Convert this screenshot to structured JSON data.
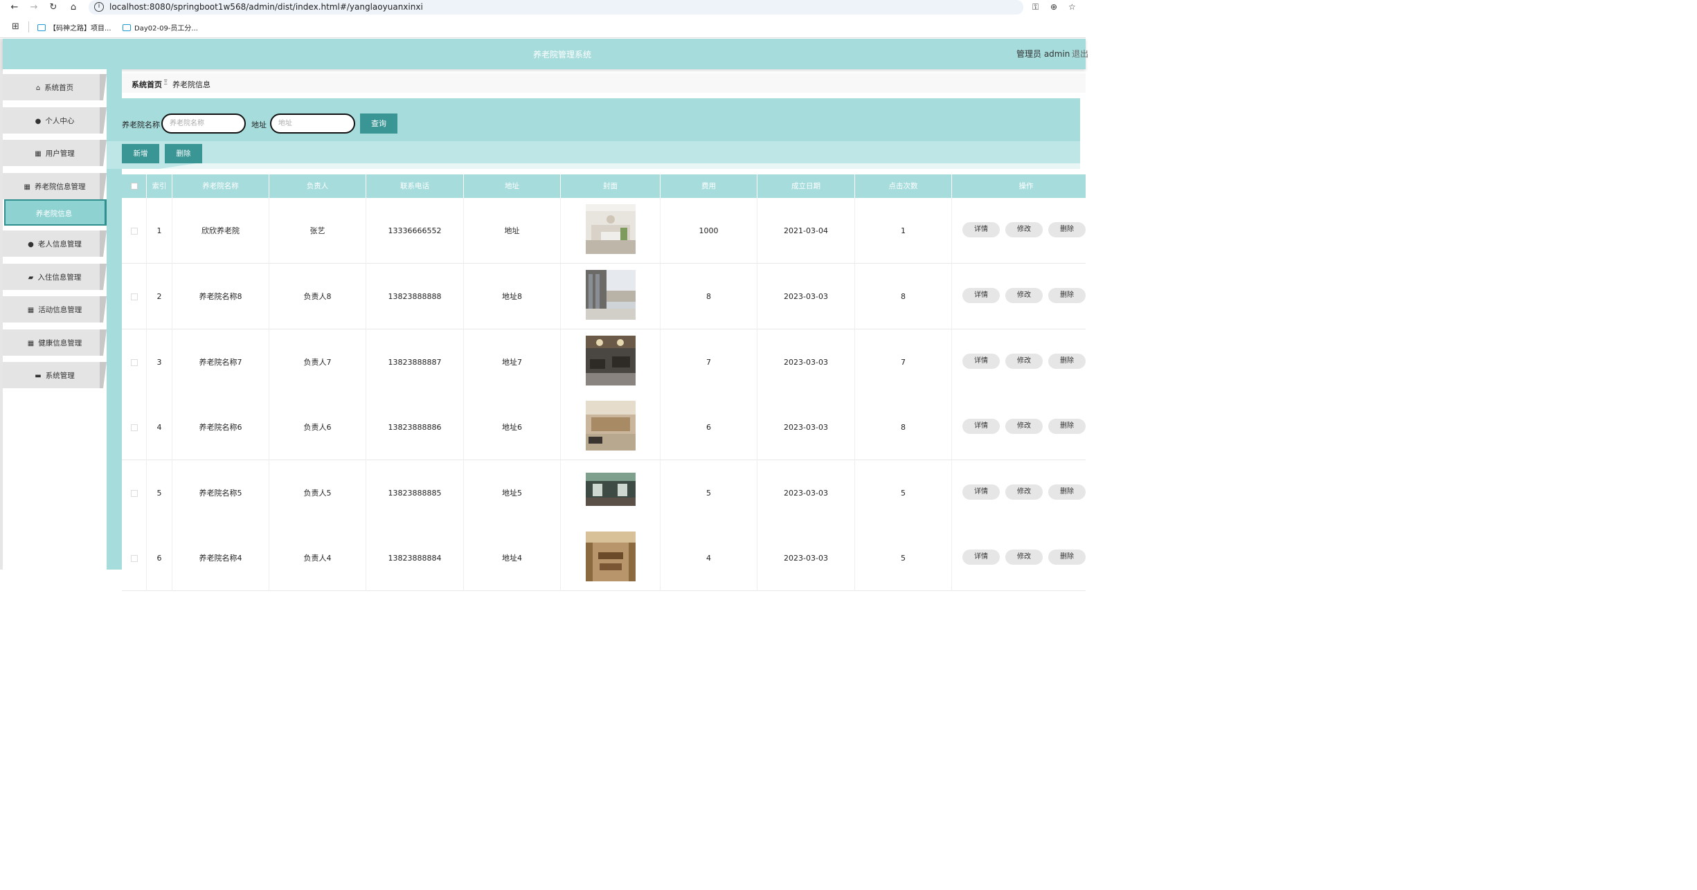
{
  "browser": {
    "url": "localhost:8080/springboot1w568/admin/dist/index.html#/yanglaoyuanxinxi",
    "bookmarks": [
      "【码神之路】项目...",
      "Day02-09-员工分..."
    ]
  },
  "header": {
    "title": "养老院管理系统",
    "admin_label": "管理员 admin",
    "logout": "退出"
  },
  "sidebar": {
    "items": [
      {
        "label": "系统首页",
        "icon": "home-icon"
      },
      {
        "label": "个人中心",
        "icon": "user-icon"
      },
      {
        "label": "用户管理",
        "icon": "grid-icon"
      },
      {
        "label": "养老院信息管理",
        "icon": "grid-icon"
      },
      {
        "label": "老人信息管理",
        "icon": "user-icon"
      },
      {
        "label": "入住信息管理",
        "icon": "chat-icon"
      },
      {
        "label": "活动信息管理",
        "icon": "grid-icon"
      },
      {
        "label": "健康信息管理",
        "icon": "grid-icon"
      },
      {
        "label": "系统管理",
        "icon": "briefcase-icon"
      }
    ],
    "active_sub": "养老院信息"
  },
  "breadcrumb": {
    "home": "系统首页",
    "separator": "Ξ",
    "current": "养老院信息"
  },
  "search": {
    "name_label": "养老院名称",
    "name_placeholder": "养老院名称",
    "address_label": "地址",
    "address_placeholder": "地址",
    "query_button": "查询"
  },
  "actions": {
    "add": "新增",
    "delete": "删除"
  },
  "table": {
    "headers": [
      "索引",
      "养老院名称",
      "负责人",
      "联系电话",
      "地址",
      "封面",
      "费用",
      "成立日期",
      "点击次数",
      "操作"
    ],
    "ops": [
      "详情",
      "修改",
      "删除"
    ],
    "rows": [
      {
        "index": "1",
        "name": "欣欣养老院",
        "manager": "张艺",
        "phone": "13336666552",
        "address": "地址",
        "fee": "1000",
        "date": "2021-03-04",
        "clicks": "1"
      },
      {
        "index": "2",
        "name": "养老院名称8",
        "manager": "负责人8",
        "phone": "13823888888",
        "address": "地址8",
        "fee": "8",
        "date": "2023-03-03",
        "clicks": "8"
      },
      {
        "index": "3",
        "name": "养老院名称7",
        "manager": "负责人7",
        "phone": "13823888887",
        "address": "地址7",
        "fee": "7",
        "date": "2023-03-03",
        "clicks": "7"
      },
      {
        "index": "4",
        "name": "养老院名称6",
        "manager": "负责人6",
        "phone": "13823888886",
        "address": "地址6",
        "fee": "6",
        "date": "2023-03-03",
        "clicks": "8"
      },
      {
        "index": "5",
        "name": "养老院名称5",
        "manager": "负责人5",
        "phone": "13823888885",
        "address": "地址5",
        "fee": "5",
        "date": "2023-03-03",
        "clicks": "5"
      },
      {
        "index": "6",
        "name": "养老院名称4",
        "manager": "负责人4",
        "phone": "13823888884",
        "address": "地址4",
        "fee": "4",
        "date": "2023-03-03",
        "clicks": "5"
      }
    ]
  },
  "colors": {
    "accent": "#a7dcdc",
    "accent_dark": "#3a9595",
    "accent_light": "#bfe6e6"
  }
}
